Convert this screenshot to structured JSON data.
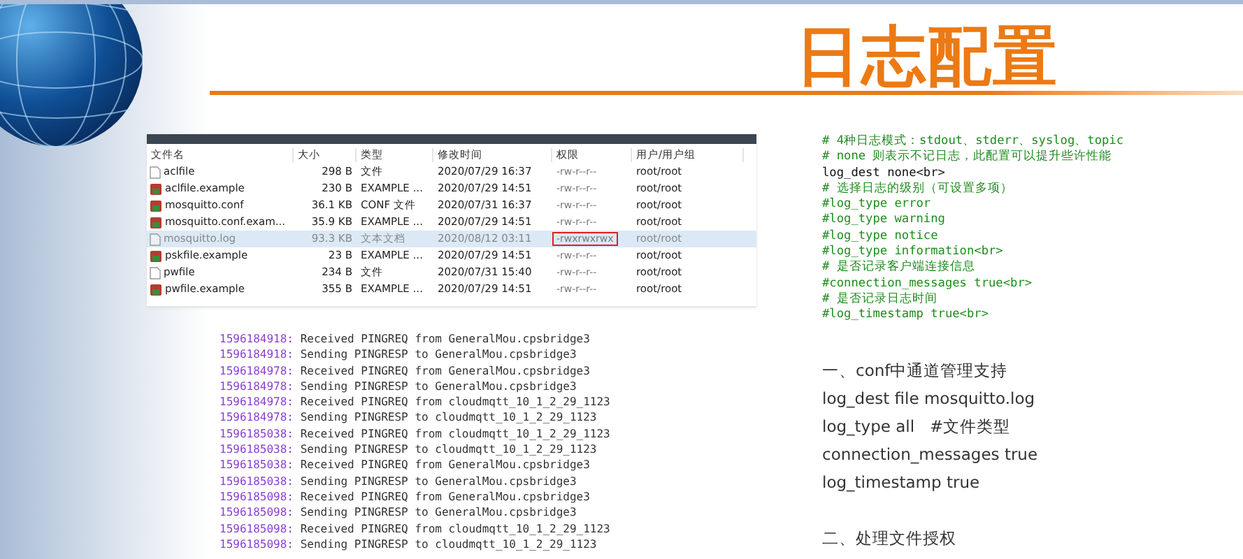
{
  "title": "日志配置",
  "file_table": {
    "columns": [
      "文件名",
      "大小",
      "类型",
      "修改时间",
      "权限",
      "用户/用户组"
    ],
    "rows": [
      {
        "kind": "plain",
        "selected": false,
        "flagged": false,
        "cells": [
          "aclfile",
          "298 B",
          "文件",
          "2020/07/29 16:37",
          "-rw-r--r--",
          "root/root"
        ]
      },
      {
        "kind": "package",
        "selected": false,
        "flagged": false,
        "cells": [
          "aclfile.example",
          "230 B",
          "EXAMPLE ...",
          "2020/07/29 14:51",
          "-rw-r--r--",
          "root/root"
        ]
      },
      {
        "kind": "package",
        "selected": false,
        "flagged": false,
        "cells": [
          "mosquitto.conf",
          "36.1 KB",
          "CONF 文件",
          "2020/07/31 16:37",
          "-rw-r--r--",
          "root/root"
        ]
      },
      {
        "kind": "package",
        "selected": false,
        "flagged": false,
        "cells": [
          "mosquitto.conf.exam...",
          "35.9 KB",
          "EXAMPLE ...",
          "2020/07/29 14:51",
          "-rw-r--r--",
          "root/root"
        ]
      },
      {
        "kind": "text",
        "selected": true,
        "flagged": true,
        "cells": [
          "mosquitto.log",
          "93.3 KB",
          "文本文档",
          "2020/08/12 03:11",
          "-rwxrwxrwx",
          "root/root"
        ]
      },
      {
        "kind": "package",
        "selected": false,
        "flagged": false,
        "cells": [
          "pskfile.example",
          "23 B",
          "EXAMPLE ...",
          "2020/07/29 14:51",
          "-rw-r--r--",
          "root/root"
        ]
      },
      {
        "kind": "plain",
        "selected": false,
        "flagged": false,
        "cells": [
          "pwfile",
          "234 B",
          "文件",
          "2020/07/31 15:40",
          "-rw-r--r--",
          "root/root"
        ]
      },
      {
        "kind": "package",
        "selected": false,
        "flagged": false,
        "cells": [
          "pwfile.example",
          "355 B",
          "EXAMPLE ...",
          "2020/07/29 14:51",
          "-rw-r--r--",
          "root/root"
        ]
      }
    ]
  },
  "log_lines": [
    {
      "time": "1596184918:",
      "message": "Received PINGREQ from GeneralMou.cpsbridge3"
    },
    {
      "time": "1596184918:",
      "message": "Sending PINGRESP to GeneralMou.cpsbridge3"
    },
    {
      "time": "1596184978:",
      "message": "Received PINGREQ from GeneralMou.cpsbridge3"
    },
    {
      "time": "1596184978:",
      "message": "Sending PINGRESP to GeneralMou.cpsbridge3"
    },
    {
      "time": "1596184978:",
      "message": "Received PINGREQ from cloudmqtt_10_1_2_29_1123"
    },
    {
      "time": "1596184978:",
      "message": "Sending PINGRESP to cloudmqtt_10_1_2_29_1123"
    },
    {
      "time": "1596185038:",
      "message": "Received PINGREQ from cloudmqtt_10_1_2_29_1123"
    },
    {
      "time": "1596185038:",
      "message": "Sending PINGRESP to cloudmqtt_10_1_2_29_1123"
    },
    {
      "time": "1596185038:",
      "message": "Received PINGREQ from GeneralMou.cpsbridge3"
    },
    {
      "time": "1596185038:",
      "message": "Sending PINGRESP to GeneralMou.cpsbridge3"
    },
    {
      "time": "1596185098:",
      "message": "Received PINGREQ from GeneralMou.cpsbridge3"
    },
    {
      "time": "1596185098:",
      "message": "Sending PINGRESP to GeneralMou.cpsbridge3"
    },
    {
      "time": "1596185098:",
      "message": "Received PINGREQ from cloudmqtt_10_1_2_29_1123"
    },
    {
      "time": "1596185098:",
      "message": "Sending PINGRESP to cloudmqtt_10_1_2_29_1123"
    }
  ],
  "config_code": [
    {
      "kind": "comment",
      "text": "# 4种日志模式：stdout、stderr、syslog、topic"
    },
    {
      "kind": "comment",
      "text": "# none 则表示不记日志，此配置可以提升些许性能"
    },
    {
      "kind": "code",
      "text": "log_dest none<br>"
    },
    {
      "kind": "comment",
      "text": "# 选择日志的级别（可设置多项）"
    },
    {
      "kind": "comment",
      "text": "#log_type error"
    },
    {
      "kind": "comment",
      "text": "#log_type warning"
    },
    {
      "kind": "comment",
      "text": "#log_type notice"
    },
    {
      "kind": "comment",
      "text": "#log_type information<br>"
    },
    {
      "kind": "comment",
      "text": "# 是否记录客户端连接信息"
    },
    {
      "kind": "comment",
      "text": "#connection_messages true<br>"
    },
    {
      "kind": "comment",
      "text": "# 是否记录日志时间"
    },
    {
      "kind": "comment",
      "text": "#log_timestamp true<br>"
    }
  ],
  "notes": [
    {
      "kind": "line",
      "text": "一、conf中通道管理支持"
    },
    {
      "kind": "line",
      "text": "log_dest file mosquitto.log"
    },
    {
      "kind": "line",
      "text": "log_type all   #文件类型"
    },
    {
      "kind": "line",
      "text": "connection_messages true"
    },
    {
      "kind": "line",
      "text": "log_timestamp true"
    },
    {
      "kind": "gap",
      "text": "二、处理文件授权"
    }
  ]
}
